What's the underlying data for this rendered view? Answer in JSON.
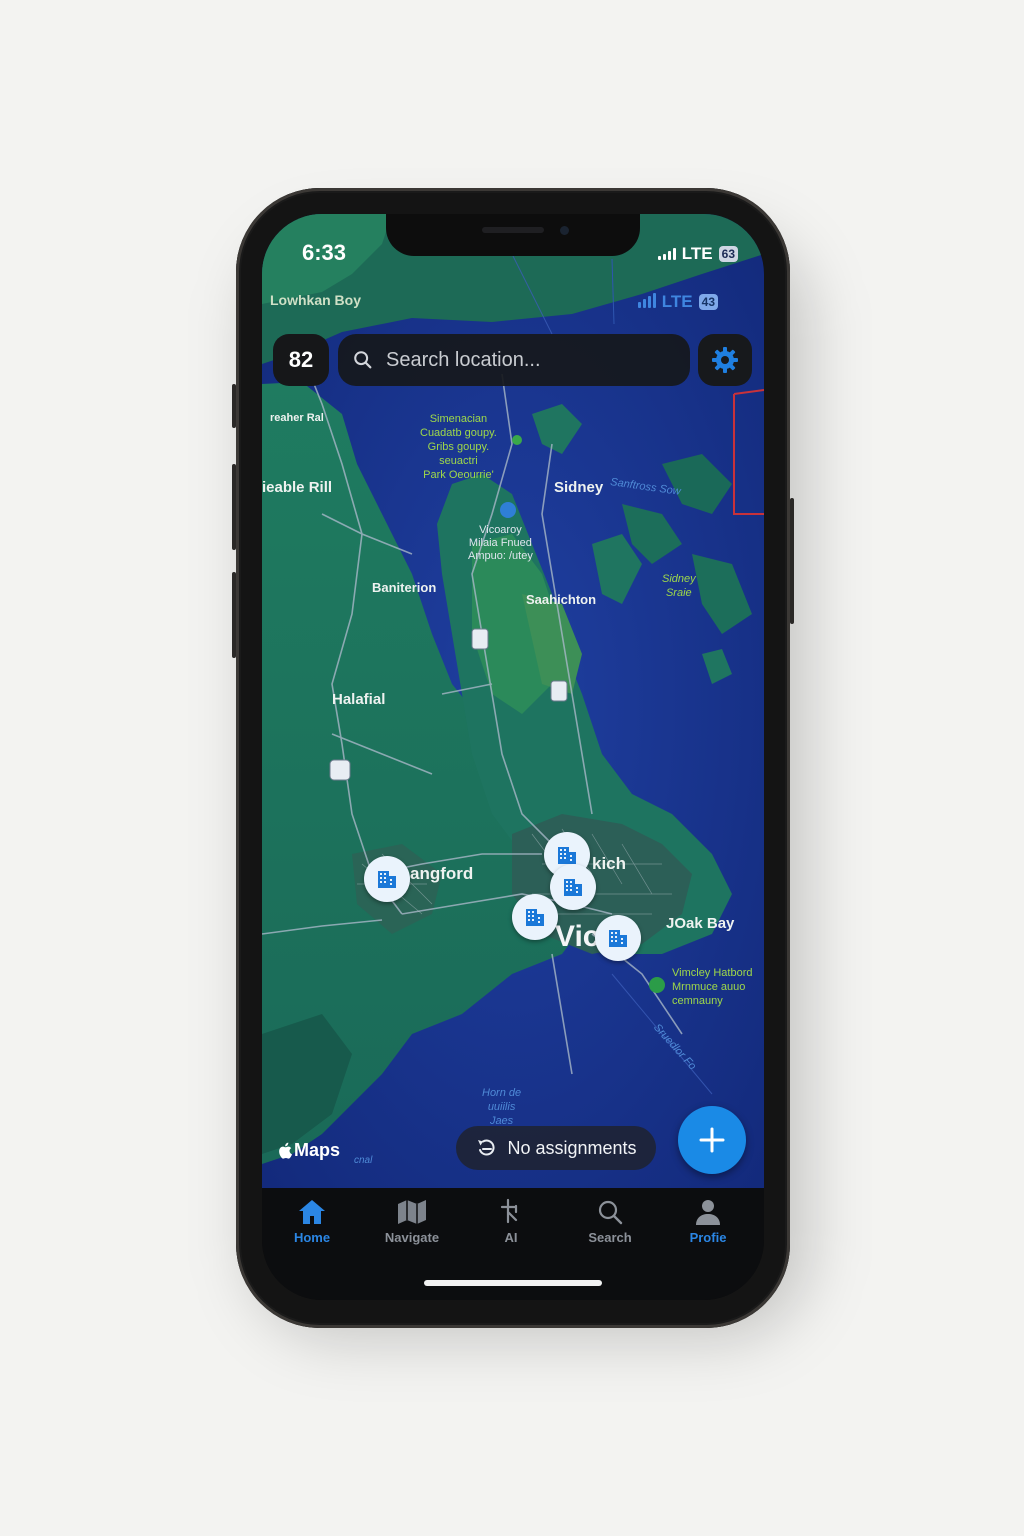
{
  "status_bar": {
    "time": "6:33",
    "network": "LTE",
    "battery": "63",
    "ghost_network": "LTE",
    "ghost_battery": "43"
  },
  "header": {
    "count_badge": "82",
    "search_placeholder": "Search location...",
    "settings_icon": "gear-icon"
  },
  "map": {
    "labels": {
      "lowhkan": "Lowhkan Boy",
      "reaher": "reaher Ral",
      "eable": "ieable Rill",
      "park_line1": "Simenacian",
      "park_line2": "Cuadatb goupy.",
      "park_line3": "Gribs goupy.",
      "park_line4": "seuactri",
      "park_line5": "Park Oeourrie'",
      "sidney": "Sidney",
      "sidney_water": "Sanftross Sow",
      "airport_line1": "Vicoaroy",
      "airport_line2": "Milaia Fnued",
      "airport_line3": "Ampuo: /utey",
      "banit": "Baniterion",
      "saanichton": "Saahichton",
      "sidney_shore_line1": "Sidney",
      "sidney_shore_line2": "Sraie",
      "halafial": "Halafial",
      "langford": "angford",
      "kich": "kich",
      "victoria": "Vic",
      "oak_bay": "JOak Bay",
      "harbour_line1": "Vimcley Hatbord",
      "harbour_line2": "Mrnmuce auuo",
      "harbour_line3": "cemnauny",
      "strait": "Sruedlor Fo",
      "water_line1": "Horn de",
      "water_line2": "uuiilis",
      "water_line3": "Jaes",
      "small_caption": "cnal"
    },
    "maps_label": "Maps",
    "pin_icon": "building-icon"
  },
  "actions": {
    "assignments_label": "No assignments",
    "add_button": "+"
  },
  "tabs": [
    {
      "label": "Home",
      "icon": "home-icon",
      "active": true
    },
    {
      "label": "Navigate",
      "icon": "map-icon",
      "active": false
    },
    {
      "label": "AI",
      "icon": "ai-icon",
      "active": false
    },
    {
      "label": "Search",
      "icon": "search-icon",
      "active": false
    },
    {
      "label": "Profie",
      "icon": "profile-icon",
      "active": false
    }
  ],
  "colors": {
    "water": "#16308a",
    "land": "#1d6b5c",
    "accent": "#1a8ae6",
    "tab_active": "#2b86e4"
  }
}
